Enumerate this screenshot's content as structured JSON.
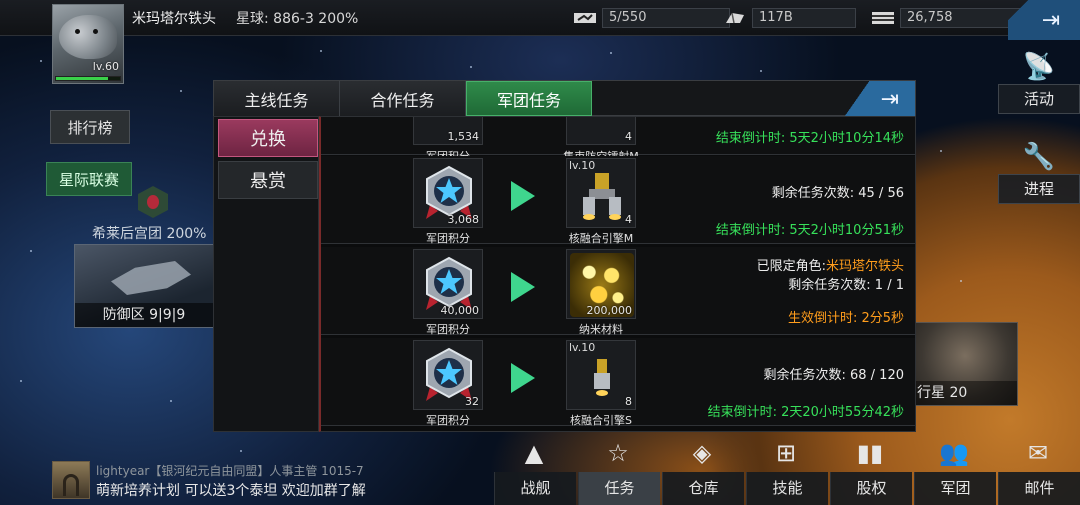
{
  "player": {
    "name": "米玛塔尔铁头",
    "level": "lv.60",
    "planet": "星球: 886-3  200%"
  },
  "resources": [
    {
      "icon": "fleet-capacity-icon",
      "value": "5/550"
    },
    {
      "icon": "material-icon",
      "value": "117B"
    },
    {
      "icon": "credits-icon",
      "value": "26,758"
    }
  ],
  "left": {
    "ranking": "排行榜",
    "league": "星际联赛",
    "guild": "希莱后宫团 200%",
    "defense": "防御区 9|9|9"
  },
  "right": {
    "activity": "活动",
    "progress": "进程",
    "planet_card": "行星 20"
  },
  "dialog": {
    "tabs": [
      "主线任务",
      "合作任务",
      "军团任务"
    ],
    "active_tab": 2,
    "side": [
      "兑换",
      "悬赏"
    ],
    "rows": [
      {
        "cost_qty": "1,534",
        "cost_name": "军团积分",
        "reward_level": "",
        "reward_qty": "4",
        "reward_name": "集束防空镭射M",
        "lines": [
          {
            "text": "结束倒计时: 5天2小时10分14秒",
            "color": "green"
          }
        ]
      },
      {
        "cost_qty": "3,068",
        "cost_name": "军团积分",
        "reward_level": "lv.10",
        "reward_qty": "4",
        "reward_name": "核融合引擎M",
        "lines": [
          {
            "text": "剩余任务次数: 45 / 56",
            "color": "white"
          },
          {
            "text": "结束倒计时: 5天2小时10分51秒",
            "color": "green"
          }
        ]
      },
      {
        "cost_qty": "40,000",
        "cost_name": "军团积分",
        "reward_level": "",
        "reward_qty": "200,000",
        "reward_name": "纳米材料",
        "role_prefix": "已限定角色:",
        "role_name": "米玛塔尔铁头",
        "lines": [
          {
            "text": "剩余任务次数: 1 / 1",
            "color": "white"
          },
          {
            "text": "生效倒计时: 2分5秒",
            "color": "orange"
          }
        ]
      },
      {
        "cost_qty": "32",
        "cost_name": "军团积分",
        "reward_level": "lv.10",
        "reward_qty": "8",
        "reward_name": "核融合引擎S",
        "lines": [
          {
            "text": "剩余任务次数: 68 / 120",
            "color": "white"
          },
          {
            "text": "结束倒计时: 2天20小时55分42秒",
            "color": "green"
          }
        ]
      }
    ]
  },
  "chat": {
    "sender": "lightyear【银河纪元自由同盟】人事主管 1015-7",
    "message": "萌新培养计划 可以送3个泰坦  欢迎加群了解"
  },
  "nav": [
    {
      "label": "战舰",
      "icon": "warship-icon"
    },
    {
      "label": "任务",
      "icon": "task-icon"
    },
    {
      "label": "仓库",
      "icon": "warehouse-icon"
    },
    {
      "label": "技能",
      "icon": "skill-tree-icon"
    },
    {
      "label": "股权",
      "icon": "bar-chart-icon"
    },
    {
      "label": "军团",
      "icon": "legion-icon"
    },
    {
      "label": "邮件",
      "icon": "mail-icon"
    }
  ],
  "nav_active": 1,
  "colors": {
    "green": "#37e05a",
    "orange": "#ff9d1c",
    "accent": "#2f8a4a"
  }
}
